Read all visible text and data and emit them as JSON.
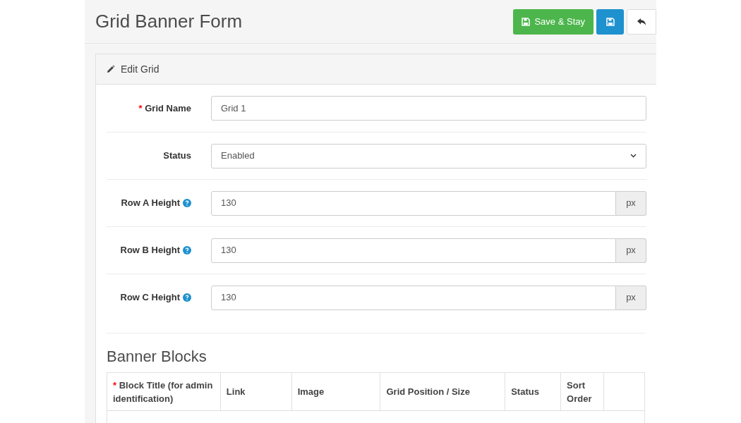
{
  "page_title": "Grid Banner Form",
  "header_buttons": [
    {
      "kind": "save_stay",
      "label": "Save & Stay"
    },
    {
      "kind": "save"
    },
    {
      "kind": "back"
    }
  ],
  "panel_title": "Edit Grid",
  "fields": [
    {
      "kind": "text",
      "required_mark": "*",
      "label": "Grid Name",
      "help": false,
      "value": "Grid 1"
    },
    {
      "kind": "select",
      "label": "Status",
      "help": false,
      "value": "Enabled"
    },
    {
      "kind": "addon",
      "label": "Row A Height",
      "help": true,
      "value": "130",
      "addon": "px"
    },
    {
      "kind": "addon",
      "label": "Row B Height",
      "help": true,
      "value": "130",
      "addon": "px"
    },
    {
      "kind": "addon",
      "label": "Row C Height",
      "help": true,
      "value": "130",
      "addon": "px"
    }
  ],
  "section_title": "Banner Blocks",
  "table": {
    "columns": [
      {
        "required_mark": "*",
        "label": "Block Title (for admin identification)"
      },
      {
        "label": "Link"
      },
      {
        "label": "Image"
      },
      {
        "label": "Grid Position / Size"
      },
      {
        "label": "Status"
      },
      {
        "label": "Sort Order"
      },
      {}
    ]
  }
}
